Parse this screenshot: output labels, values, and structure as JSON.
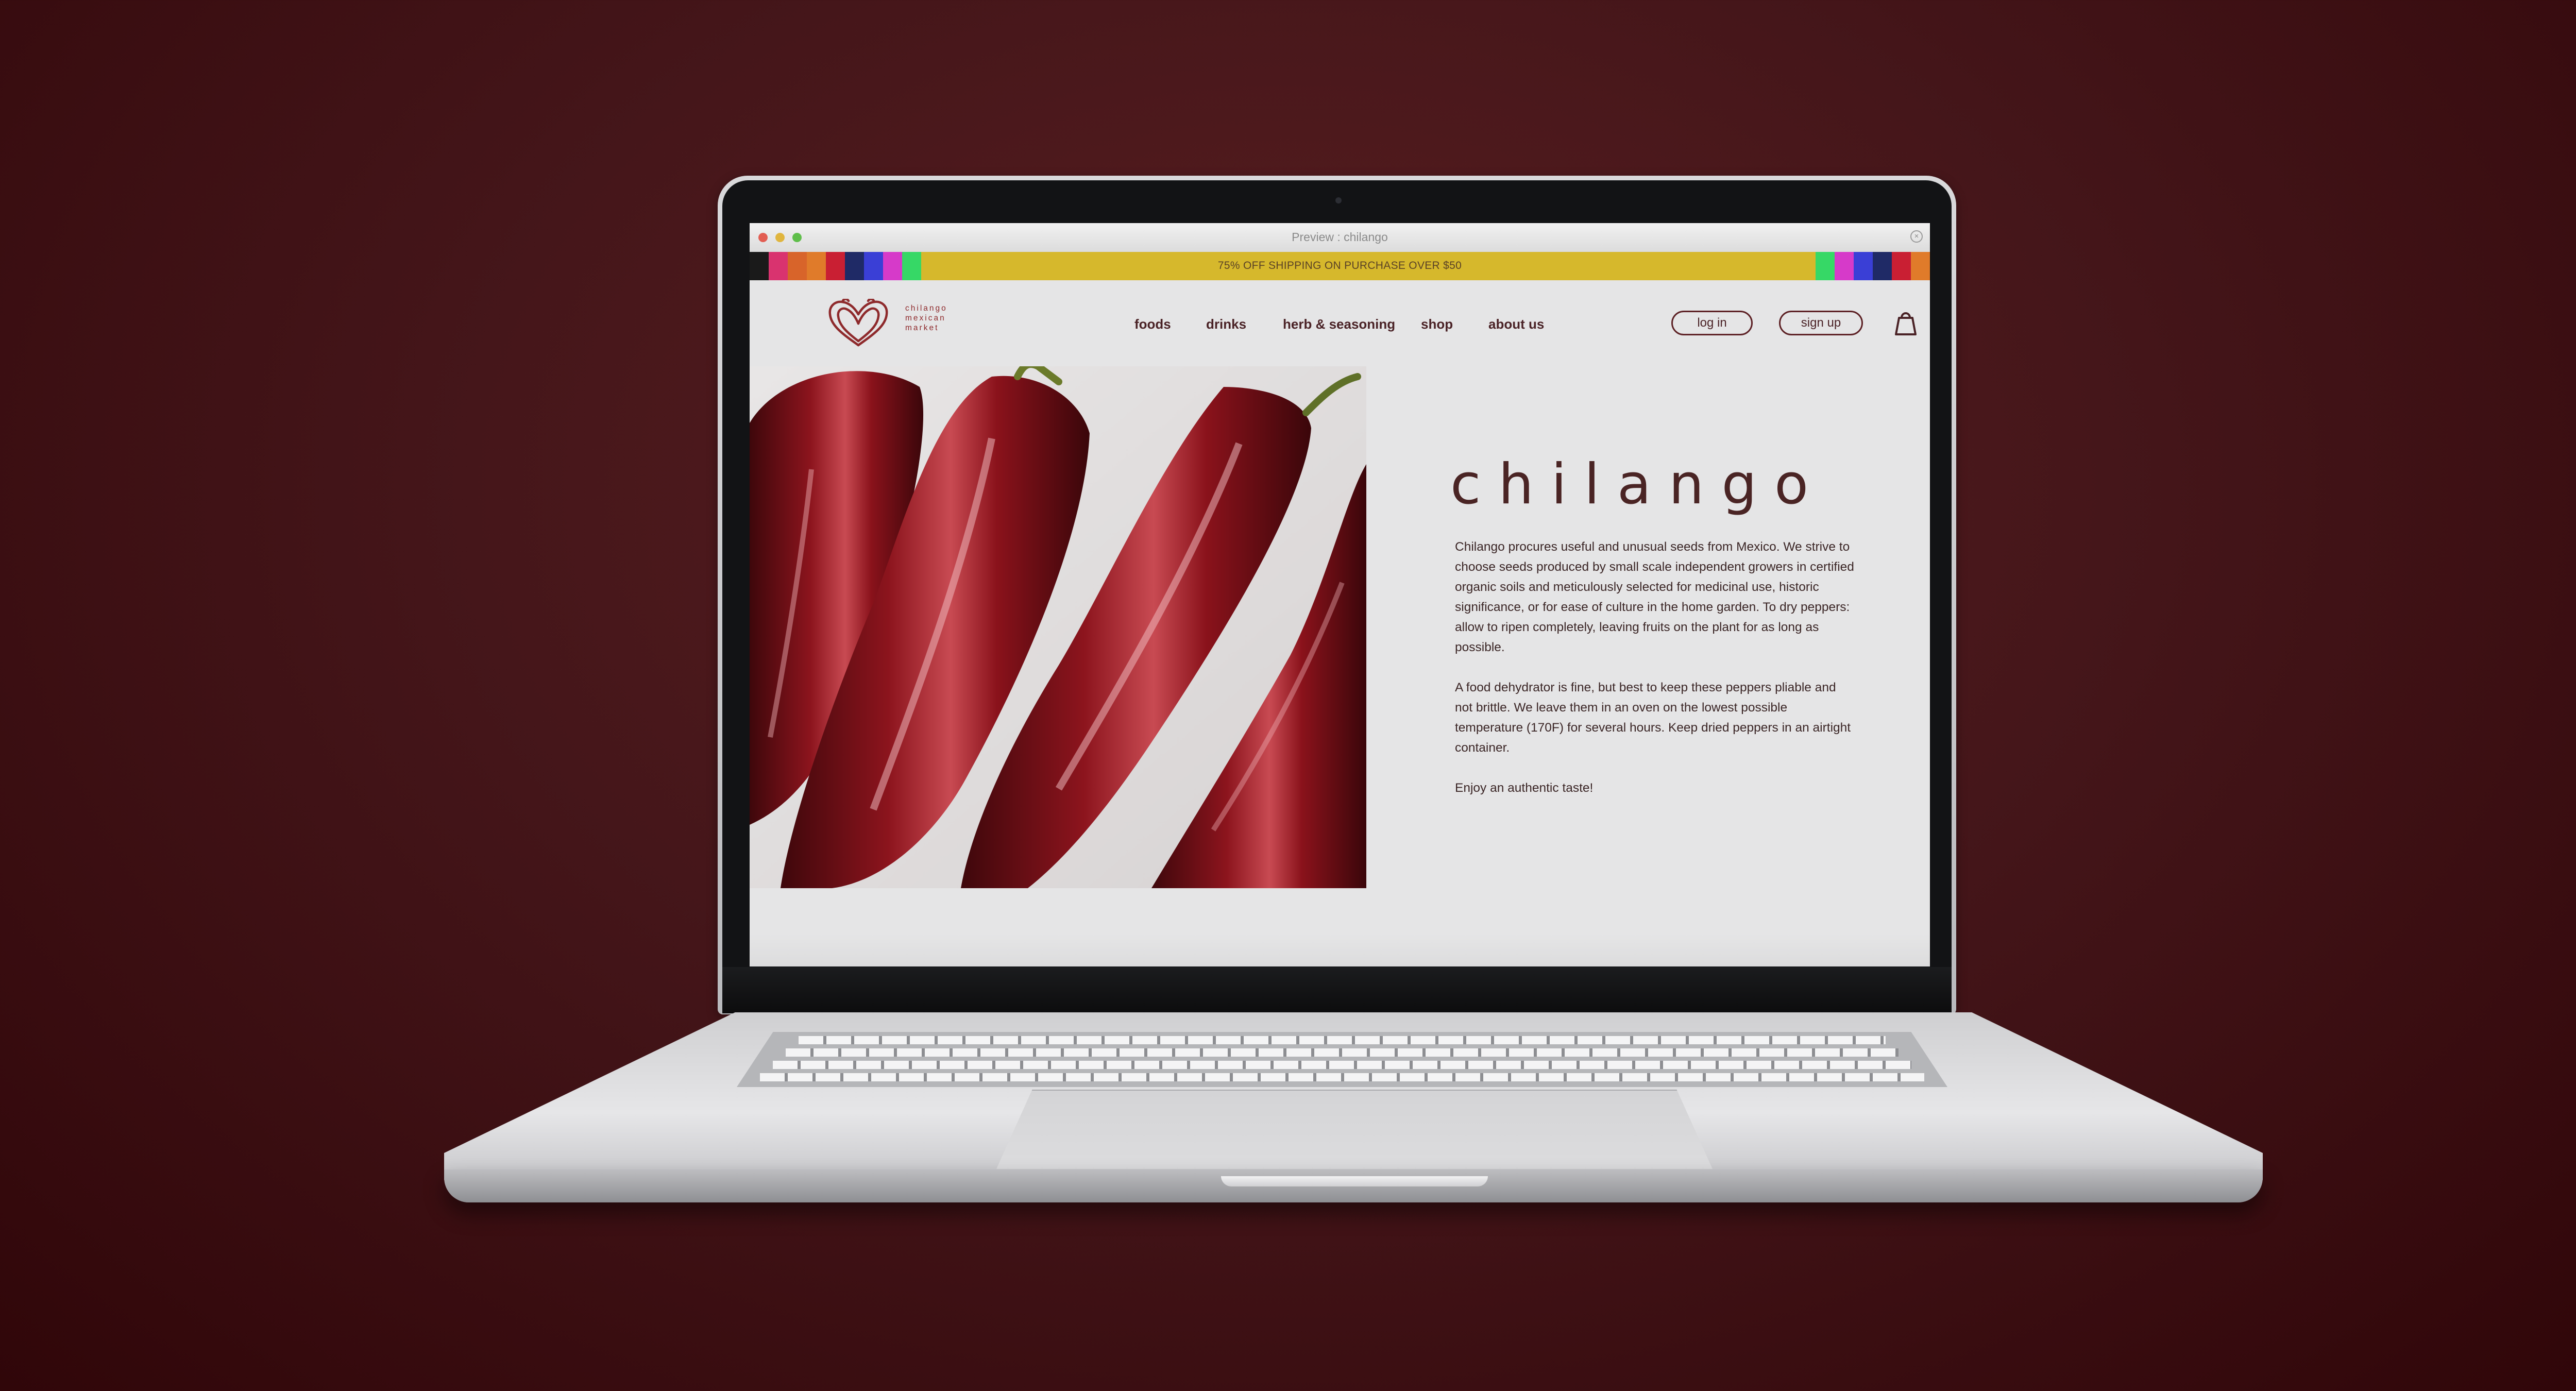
{
  "window": {
    "title": "Preview : chilango"
  },
  "promo": {
    "text": "75% OFF SHIPPING ON PURCHASE OVER $50",
    "bar_color": "#d6b82c",
    "stripe_colors_left": [
      "#1a1a1a",
      "#d9336f",
      "#d8642a",
      "#e07b2a",
      "#c91f33",
      "#1f2a66",
      "#3a3fd6",
      "#d63ac9",
      "#36d866"
    ],
    "stripe_colors_right": [
      "#36d866",
      "#d63ac9",
      "#3a3fd6",
      "#1f2a66",
      "#c91f33",
      "#e07b2a"
    ]
  },
  "header": {
    "logo_lines": [
      "chilango",
      "mexican",
      "market"
    ],
    "nav": [
      "foods",
      "drinks",
      "herb & seasoning",
      "shop",
      "about us"
    ],
    "login_label": "log in",
    "signup_label": "sign up",
    "cart_icon": "shopping-bag-icon"
  },
  "hero": {
    "image": "dried red chili peppers photo",
    "title": "chilango",
    "paragraphs": [
      "Chilango procures useful and unusual seeds from Mexico. We strive to choose seeds produced by small scale independent growers in certified organic soils and meticulously selected for medicinal use, historic significance, or for ease of culture in the home garden. To dry peppers: allow to ripen completely, leaving fruits on the plant for as long as possible.",
      "A food dehydrator is fine, but best to keep these peppers pliable and not brittle. We leave them in an oven on the lowest possible temperature (170F) for several hours. Keep dried peppers in an airtight container.",
      "Enjoy an authentic taste!"
    ]
  },
  "colors": {
    "brand": "#8e2a2c",
    "text_dark": "#4a2226",
    "background": "#e5e5e6"
  }
}
